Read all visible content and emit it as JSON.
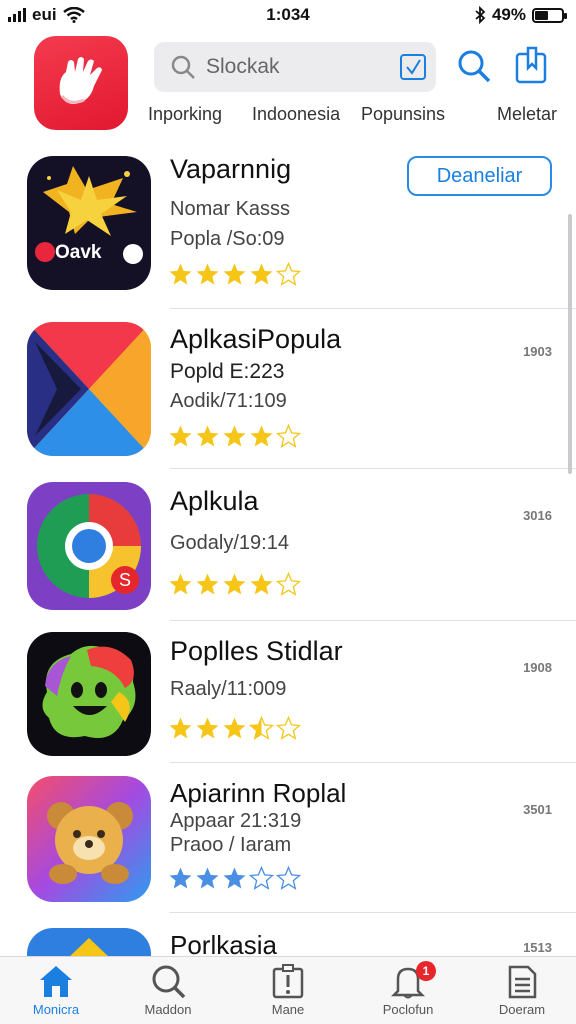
{
  "status_bar": {
    "carrier": "eui",
    "time": "1:034",
    "battery": "49%",
    "battery_level": 0.49
  },
  "header": {
    "search": {
      "placeholder": "Slockak"
    },
    "categories": [
      "Inporking",
      "Indoonesia",
      "Popunsins",
      "Meletar"
    ]
  },
  "apps": [
    {
      "title": "Vaparnnig",
      "lines": [
        "Nomar Kasss",
        "Popla /So:09"
      ],
      "meta": "",
      "rating": 4,
      "action": "Deaneliar",
      "icon_text": "Oavk"
    },
    {
      "title": "AplkasiPopula",
      "lines": [
        "Popld E:223",
        "Aodik/71:109"
      ],
      "meta": "1903",
      "rating": 4
    },
    {
      "title": "Aplkula",
      "lines": [
        "Godaly/19:14"
      ],
      "meta": "3016",
      "rating": 4
    },
    {
      "title": "Poplles Stidlar",
      "lines": [
        "Raaly/11:009"
      ],
      "meta": "1908",
      "rating": 3.5
    },
    {
      "title": "Apiarinn Roplal",
      "lines": [
        "Appaar 21:319",
        "Praoo / Iaram"
      ],
      "meta": "3501",
      "rating": 3,
      "star_color": "#4a8fe3"
    },
    {
      "title": "Porlkasia",
      "lines": [],
      "meta": "1513",
      "rating": 0
    }
  ],
  "tab_bar": [
    {
      "label": "Monicra",
      "icon": "home-icon",
      "active": true
    },
    {
      "label": "Maddon",
      "icon": "search-icon"
    },
    {
      "label": "Mane",
      "icon": "alert-icon"
    },
    {
      "label": "Poclofun",
      "icon": "bell-icon",
      "badge": "1"
    },
    {
      "label": "Doeram",
      "icon": "document-icon"
    }
  ],
  "colors": {
    "accent": "#1b7fe0",
    "star": "#f5c518",
    "logo": "#e9263b",
    "badge": "#e5262b"
  }
}
